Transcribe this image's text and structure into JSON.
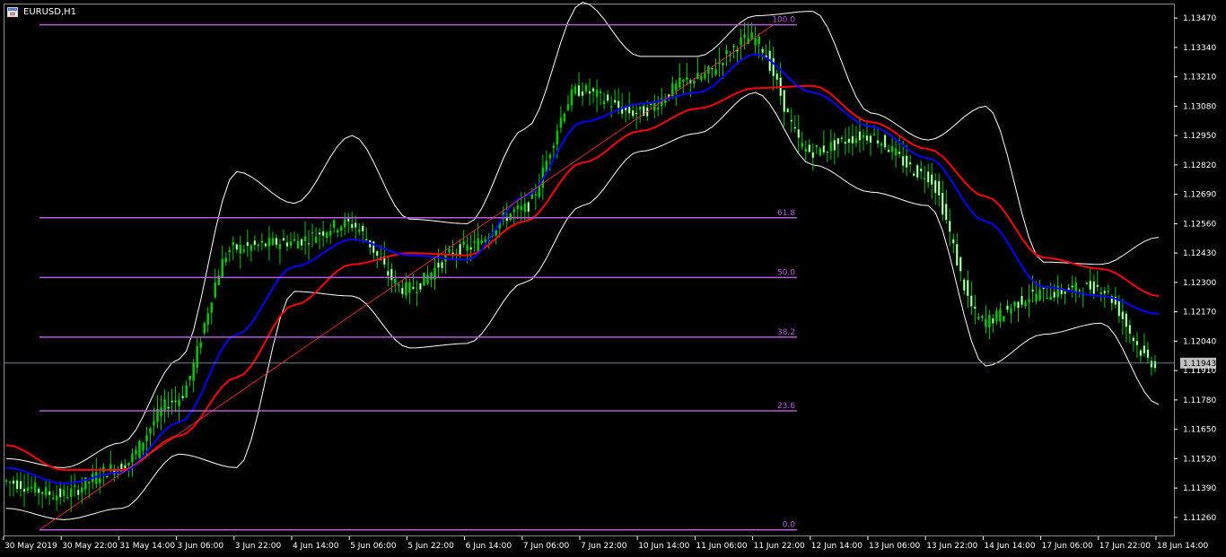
{
  "window": {
    "title": "EURUSD,H1"
  },
  "colors": {
    "background": "#000000",
    "frame": "#8c8c8c",
    "candle_bull": "#00c800",
    "candle_bear": "#e8ffe8",
    "ma_fast": "#0000ff",
    "ma_slow": "#ff0000",
    "bollinger": "#ffffff",
    "fib_level": "#b35ed6",
    "trend_line": "#ff3030",
    "price_line": "#708090",
    "price_tag_bg": "#c0c0c0"
  },
  "chart_data": {
    "type": "candlestick",
    "symbol": "EURUSD",
    "timeframe": "H1",
    "ylim": [
      1.1118,
      1.1353
    ],
    "y_ticks": [
      "1.13470",
      "1.13340",
      "1.13210",
      "1.13080",
      "1.12950",
      "1.12820",
      "1.12690",
      "1.12560",
      "1.12430",
      "1.12300",
      "1.12170",
      "1.12040",
      "1.11910",
      "1.11780",
      "1.11650",
      "1.11520",
      "1.11390",
      "1.11260"
    ],
    "x_ticks": [
      "30 May 2019",
      "30 May 22:00",
      "31 May 14:00",
      "3 Jun 06:00",
      "3 Jun 22:00",
      "4 Jun 14:00",
      "5 Jun 06:00",
      "5 Jun 22:00",
      "6 Jun 14:00",
      "7 Jun 06:00",
      "7 Jun 22:00",
      "10 Jun 14:00",
      "11 Jun 06:00",
      "11 Jun 22:00",
      "12 Jun 14:00",
      "13 Jun 06:00",
      "13 Jun 22:00",
      "14 Jun 14:00",
      "17 Jun 06:00",
      "17 Jun 22:00",
      "18 Jun 14:00"
    ],
    "current_price": "1.11943",
    "fibonacci": {
      "low": 1.11205,
      "high": 1.1344,
      "levels": [
        {
          "label": "100.0",
          "price": 1.1344
        },
        {
          "label": "61.8",
          "price": 1.12586
        },
        {
          "label": "50.0",
          "price": 1.12322
        },
        {
          "label": "38.2",
          "price": 1.12058
        },
        {
          "label": "23.6",
          "price": 1.11732
        },
        {
          "label": "0.0",
          "price": 1.11205
        }
      ]
    },
    "trend_line": {
      "from": [
        "30 May 2019",
        1.11205
      ],
      "to": [
        "11 Jun 22:00",
        1.1344
      ]
    },
    "close_path": [
      [
        "30 May 2019",
        1.1142
      ],
      [
        "30 May 22:00",
        1.1136
      ],
      [
        "31 May 14:00",
        1.1148
      ],
      [
        "3 Jun 06:00",
        1.1178
      ],
      [
        "3 Jun 22:00",
        1.1245
      ],
      [
        "4 Jun 14:00",
        1.1248
      ],
      [
        "5 Jun 06:00",
        1.1256
      ],
      [
        "5 Jun 22:00",
        1.1227
      ],
      [
        "6 Jun 14:00",
        1.1245
      ],
      [
        "7 Jun 06:00",
        1.1262
      ],
      [
        "7 Jun 22:00",
        1.1315
      ],
      [
        "10 Jun 14:00",
        1.1305
      ],
      [
        "11 Jun 06:00",
        1.132
      ],
      [
        "11 Jun 22:00",
        1.1338
      ],
      [
        "12 Jun 14:00",
        1.1288
      ],
      [
        "13 Jun 06:00",
        1.1295
      ],
      [
        "13 Jun 22:00",
        1.1278
      ],
      [
        "14 Jun 14:00",
        1.1213
      ],
      [
        "17 Jun 06:00",
        1.1225
      ],
      [
        "17 Jun 22:00",
        1.1228
      ],
      [
        "18 Jun 14:00",
        1.11943
      ]
    ],
    "ma_fast_path": [
      [
        "30 May 2019",
        1.1148
      ],
      [
        "30 May 22:00",
        1.1141
      ],
      [
        "31 May 14:00",
        1.1146
      ],
      [
        "3 Jun 06:00",
        1.1168
      ],
      [
        "3 Jun 22:00",
        1.1207
      ],
      [
        "4 Jun 14:00",
        1.1237
      ],
      [
        "5 Jun 06:00",
        1.1249
      ],
      [
        "5 Jun 22:00",
        1.1242
      ],
      [
        "6 Jun 14:00",
        1.124
      ],
      [
        "7 Jun 06:00",
        1.1268
      ],
      [
        "7 Jun 22:00",
        1.1301
      ],
      [
        "10 Jun 14:00",
        1.1309
      ],
      [
        "11 Jun 06:00",
        1.1314
      ],
      [
        "11 Jun 22:00",
        1.1331
      ],
      [
        "12 Jun 14:00",
        1.1314
      ],
      [
        "13 Jun 06:00",
        1.1299
      ],
      [
        "13 Jun 22:00",
        1.1285
      ],
      [
        "14 Jun 14:00",
        1.1257
      ],
      [
        "17 Jun 06:00",
        1.1228
      ],
      [
        "17 Jun 22:00",
        1.1224
      ],
      [
        "18 Jun 14:00",
        1.1216
      ]
    ],
    "ma_slow_path": [
      [
        "30 May 2019",
        1.1158
      ],
      [
        "30 May 22:00",
        1.1147
      ],
      [
        "31 May 14:00",
        1.1147
      ],
      [
        "3 Jun 06:00",
        1.1162
      ],
      [
        "3 Jun 22:00",
        1.1188
      ],
      [
        "4 Jun 14:00",
        1.122
      ],
      [
        "5 Jun 06:00",
        1.1238
      ],
      [
        "5 Jun 22:00",
        1.1243
      ],
      [
        "6 Jun 14:00",
        1.1242
      ],
      [
        "7 Jun 06:00",
        1.1257
      ],
      [
        "7 Jun 22:00",
        1.1283
      ],
      [
        "10 Jun 14:00",
        1.1297
      ],
      [
        "11 Jun 06:00",
        1.1307
      ],
      [
        "11 Jun 22:00",
        1.1316
      ],
      [
        "12 Jun 14:00",
        1.1317
      ],
      [
        "13 Jun 06:00",
        1.1301
      ],
      [
        "13 Jun 22:00",
        1.1289
      ],
      [
        "14 Jun 14:00",
        1.1268
      ],
      [
        "17 Jun 06:00",
        1.1241
      ],
      [
        "17 Jun 22:00",
        1.1236
      ],
      [
        "18 Jun 14:00",
        1.1224
      ]
    ],
    "bb_upper_path": [
      [
        "30 May 2019",
        1.1152
      ],
      [
        "30 May 22:00",
        1.1148
      ],
      [
        "31 May 14:00",
        1.1159
      ],
      [
        "3 Jun 06:00",
        1.1196
      ],
      [
        "3 Jun 22:00",
        1.1279
      ],
      [
        "4 Jun 14:00",
        1.1265
      ],
      [
        "5 Jun 06:00",
        1.1295
      ],
      [
        "5 Jun 22:00",
        1.1258
      ],
      [
        "6 Jun 14:00",
        1.1256
      ],
      [
        "7 Jun 06:00",
        1.1298
      ],
      [
        "7 Jun 22:00",
        1.1354
      ],
      [
        "10 Jun 14:00",
        1.133
      ],
      [
        "11 Jun 06:00",
        1.133
      ],
      [
        "11 Jun 22:00",
        1.1348
      ],
      [
        "12 Jun 14:00",
        1.135
      ],
      [
        "13 Jun 06:00",
        1.1305
      ],
      [
        "13 Jun 22:00",
        1.1293
      ],
      [
        "14 Jun 14:00",
        1.1308
      ],
      [
        "17 Jun 06:00",
        1.1239
      ],
      [
        "17 Jun 22:00",
        1.1238
      ],
      [
        "18 Jun 14:00",
        1.125
      ]
    ],
    "bb_lower_path": [
      [
        "30 May 2019",
        1.113
      ],
      [
        "30 May 22:00",
        1.1125
      ],
      [
        "31 May 14:00",
        1.113
      ],
      [
        "3 Jun 06:00",
        1.1154
      ],
      [
        "3 Jun 22:00",
        1.1148
      ],
      [
        "4 Jun 14:00",
        1.1226
      ],
      [
        "5 Jun 06:00",
        1.1224
      ],
      [
        "5 Jun 22:00",
        1.1201
      ],
      [
        "6 Jun 14:00",
        1.1203
      ],
      [
        "7 Jun 06:00",
        1.123
      ],
      [
        "7 Jun 22:00",
        1.1264
      ],
      [
        "10 Jun 14:00",
        1.1288
      ],
      [
        "11 Jun 06:00",
        1.1296
      ],
      [
        "11 Jun 22:00",
        1.1314
      ],
      [
        "12 Jun 14:00",
        1.1282
      ],
      [
        "13 Jun 06:00",
        1.127
      ],
      [
        "13 Jun 22:00",
        1.1264
      ],
      [
        "14 Jun 14:00",
        1.1193
      ],
      [
        "17 Jun 06:00",
        1.1207
      ],
      [
        "17 Jun 22:00",
        1.1212
      ],
      [
        "18 Jun 14:00",
        1.1176
      ]
    ]
  }
}
